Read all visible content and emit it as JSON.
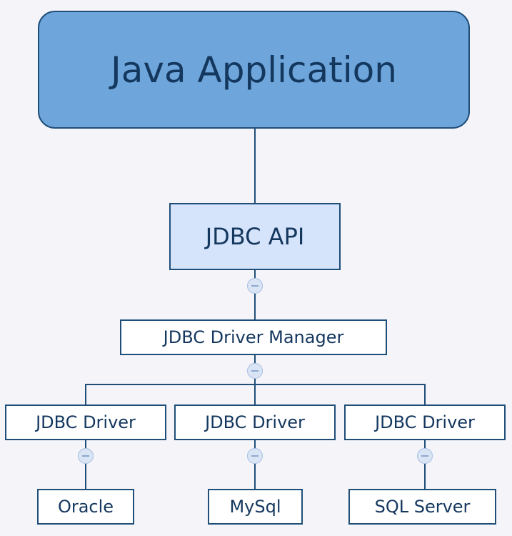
{
  "diagram": {
    "root": {
      "label": "Java Application"
    },
    "api": {
      "label": "JDBC API"
    },
    "manager": {
      "label": "JDBC Driver Manager"
    },
    "drivers": [
      {
        "label": "JDBC Driver",
        "database": "Oracle"
      },
      {
        "label": "JDBC Driver",
        "database": "MySql"
      },
      {
        "label": "JDBC Driver",
        "database": "SQL Server"
      }
    ],
    "collapse_icon": "minus-circle-icon",
    "colors": {
      "background": "#f4f4f9",
      "root_fill": "#6ea6dc",
      "api_fill": "#d6e4fb",
      "box_fill": "#ffffff",
      "border": "#1f4e79",
      "text": "#14375e"
    }
  }
}
